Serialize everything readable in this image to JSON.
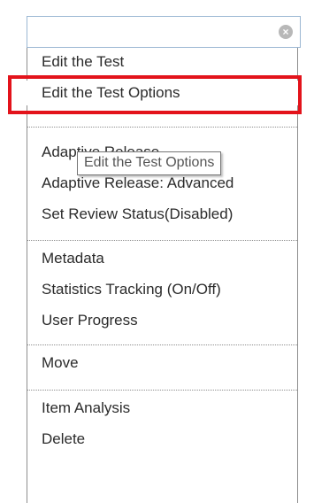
{
  "menu": {
    "close_icon": "×",
    "items": [
      {
        "label": "Edit the Test"
      },
      {
        "label": "Edit the Test Options"
      },
      {
        "label": "Adaptive Release"
      },
      {
        "label": "Adaptive Release: Advanced"
      },
      {
        "label": "Set Review Status(Disabled)"
      },
      {
        "label": "Metadata"
      },
      {
        "label": "Statistics Tracking (On/Off)"
      },
      {
        "label": "User Progress"
      },
      {
        "label": "Move"
      },
      {
        "label": "Item Analysis"
      },
      {
        "label": "Delete"
      }
    ]
  },
  "tooltip": {
    "text": "Edit the Test Options"
  },
  "colors": {
    "highlight_border": "#e3131b",
    "header_border": "#9bb7d3",
    "text": "#2b2b2b"
  }
}
